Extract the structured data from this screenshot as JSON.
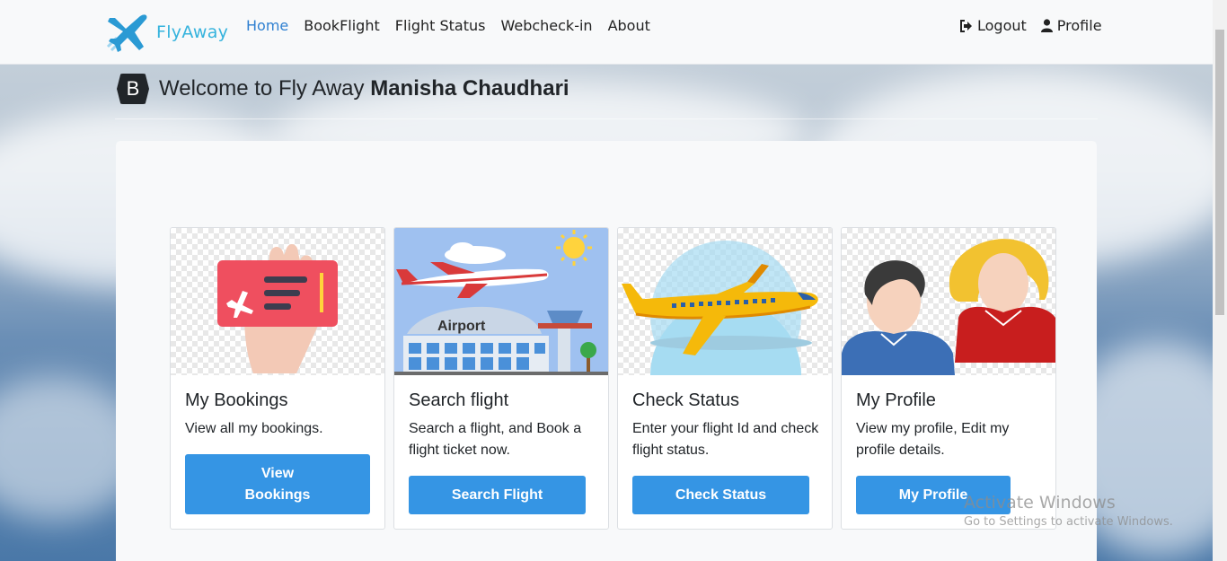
{
  "brand": {
    "name": "FlyAway"
  },
  "nav": {
    "links": [
      "Home",
      "BookFlight",
      "Flight Status",
      "Webcheck-in",
      "About"
    ],
    "logout": "Logout",
    "profile": "Profile"
  },
  "welcome": {
    "prefix": "Welcome to Fly Away ",
    "user_name": "Manisha Chaudhari",
    "logo_letter": "B"
  },
  "cards": [
    {
      "title": "My Bookings",
      "text": "View all my bookings.",
      "button": "View Bookings"
    },
    {
      "title": "Search flight",
      "text": "Search a flight, and Book a flight ticket now.",
      "button": "Search Flight",
      "image_label": "Airport"
    },
    {
      "title": "Check Status",
      "text": "Enter your flight Id and check flight status.",
      "button": "Check Status"
    },
    {
      "title": "My Profile",
      "text": "View my profile, Edit my profile details.",
      "button": "My Profile"
    }
  ],
  "watermark": {
    "title": "Activate Windows",
    "subtitle": "Go to Settings to activate Windows."
  },
  "colors": {
    "brand": "#35b3dd",
    "active_link": "#2f80d1",
    "button": "#3595e4"
  }
}
